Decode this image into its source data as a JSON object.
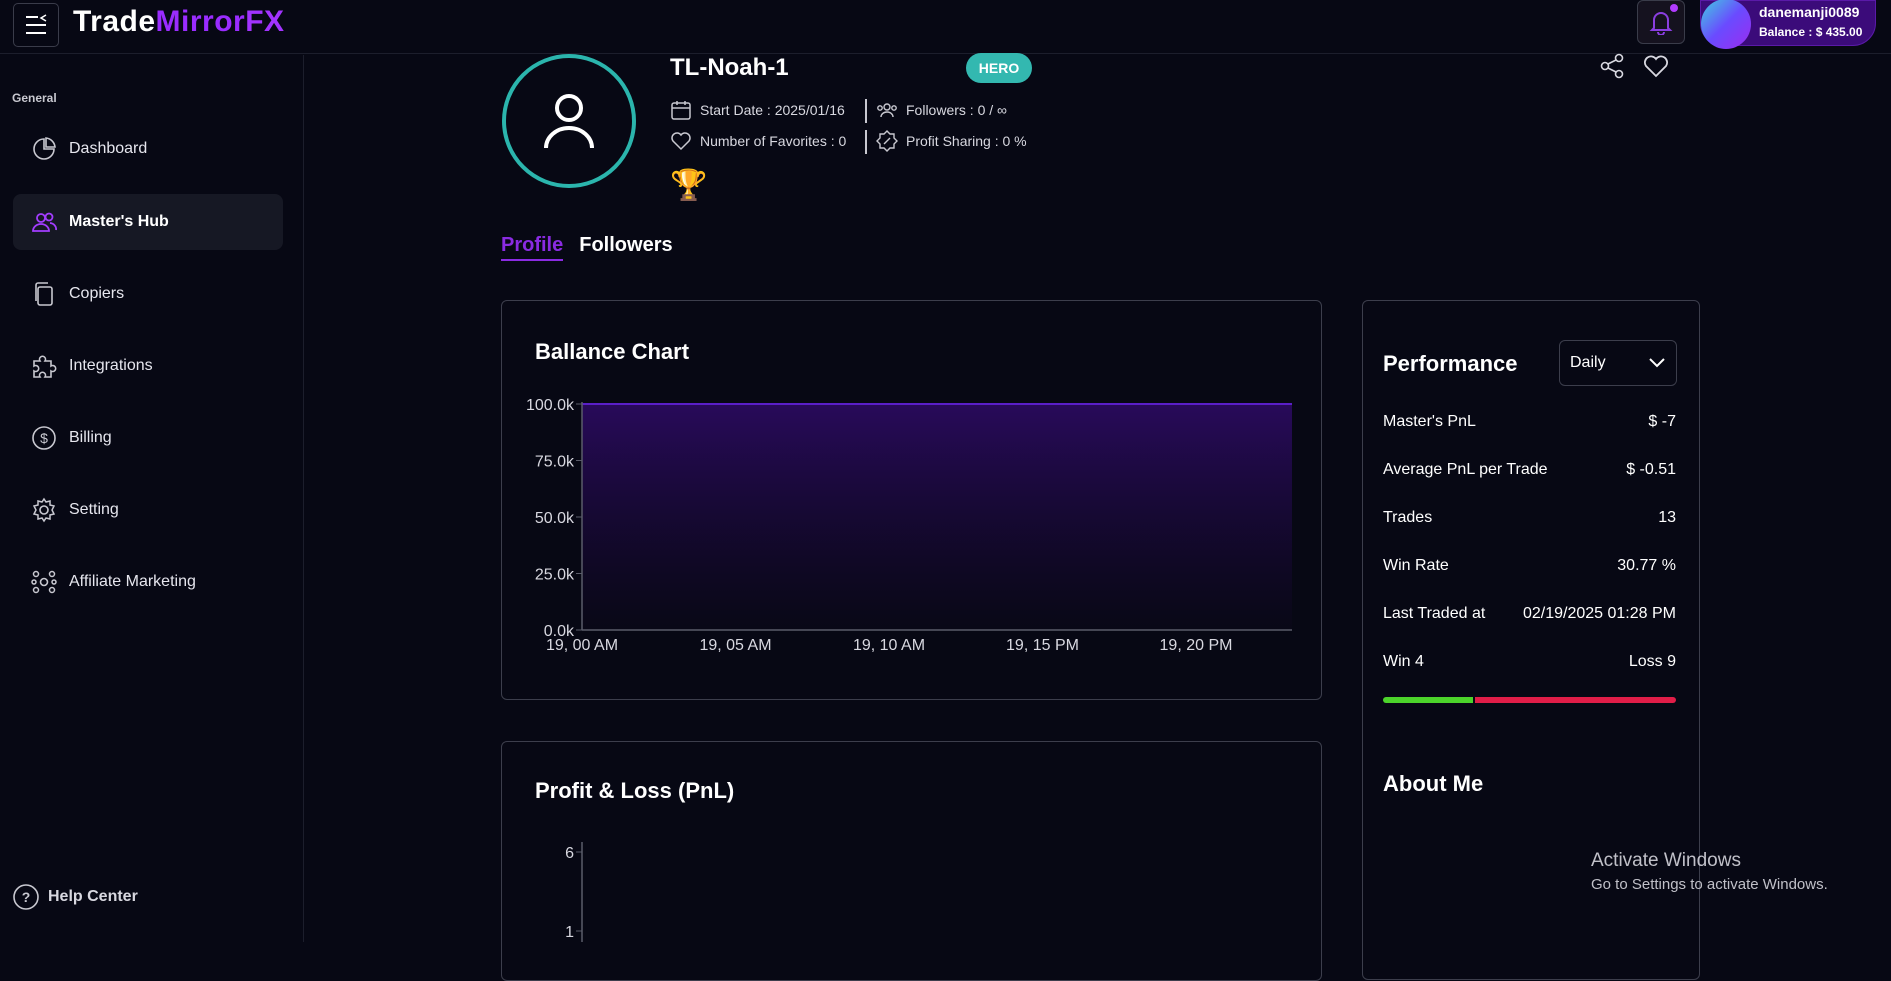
{
  "header": {
    "logo_part1": "Trade",
    "logo_part2": "Mirror",
    "logo_part3": "FX",
    "username": "danemanji0089",
    "balance": "Balance : $ 435.00"
  },
  "sidebar": {
    "heading": "General",
    "items": [
      {
        "label": "Dashboard",
        "icon": "pie-chart-icon"
      },
      {
        "label": "Master's Hub",
        "icon": "users-icon",
        "active": true
      },
      {
        "label": "Copiers",
        "icon": "copy-icon"
      },
      {
        "label": "Integrations",
        "icon": "puzzle-icon"
      },
      {
        "label": "Billing",
        "icon": "dollar-icon"
      },
      {
        "label": "Setting",
        "icon": "gear-icon"
      },
      {
        "label": "Affiliate Marketing",
        "icon": "network-icon"
      }
    ],
    "help": "Help Center"
  },
  "trader": {
    "name": "TL-Noah-1",
    "badge": "HERO",
    "start_date": "Start Date : 2025/01/16",
    "followers": "Followers : 0 / ∞",
    "favorites": "Number of Favorites : 0",
    "profit_sharing": "Profit Sharing : 0 %"
  },
  "tabs": {
    "profile": "Profile",
    "followers": "Followers"
  },
  "balance_card": {
    "title": "Ballance Chart"
  },
  "pnl_card": {
    "title": "Profit & Loss (PnL)",
    "tick_top": "6",
    "tick_bottom": "1"
  },
  "performance": {
    "title": "Performance",
    "period": "Daily",
    "rows": [
      {
        "label": "Master's PnL",
        "value": "$ -7"
      },
      {
        "label": "Average PnL per Trade",
        "value": "$ -0.51"
      },
      {
        "label": "Trades",
        "value": "13"
      },
      {
        "label": "Win Rate",
        "value": "30.77 %"
      },
      {
        "label": "Last Traded at",
        "value": "02/19/2025 01:28 PM"
      }
    ],
    "win_label": "Win 4",
    "loss_label": "Loss 9",
    "wins": 4,
    "losses": 9,
    "win_color": "#4cd42b",
    "loss_color": "#e11d48",
    "about_title": "About Me"
  },
  "watermark": {
    "line1": "Activate Windows",
    "line2": "Go to Settings to activate Windows."
  },
  "chart_data": {
    "type": "area",
    "title": "Ballance Chart",
    "x": [
      "19, 00 AM",
      "19, 05 AM",
      "19, 10 AM",
      "19, 15 PM",
      "19, 20 PM"
    ],
    "y_ticks": [
      "100.0k",
      "75.0k",
      "50.0k",
      "25.0k",
      "0.0k"
    ],
    "series": [
      {
        "values": [
          100000,
          100000,
          100000,
          100000,
          100000,
          100000
        ]
      }
    ],
    "ylim": [
      0,
      100000
    ],
    "colors": {
      "line": "#5a1fc8",
      "fill_top": "#2a0a5e"
    }
  }
}
